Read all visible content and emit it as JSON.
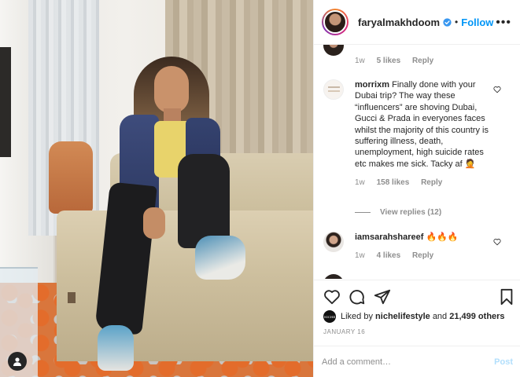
{
  "header": {
    "username": "faryalmakhdoom",
    "dot": "•",
    "follow_label": "Follow",
    "more_label": "•••"
  },
  "comments": [
    {
      "user": "",
      "text": "",
      "time": "1w",
      "likes": "5 likes",
      "reply": "Reply"
    },
    {
      "user": "morrixm",
      "text": "Finally done with your Dubai trip? The way these “influencers” are shoving Dubai, Gucci & Prada in everyones faces whilst the majority of this country is suffering illness, death, unemployment, high suicide rates etc makes me sick. Tacky af 🤦",
      "time": "1w",
      "likes": "158 likes",
      "reply": "Reply",
      "view_replies": "View replies (12)"
    },
    {
      "user": "iamsarahshareef",
      "text": "🔥🔥🔥",
      "time": "1w",
      "likes": "4 likes",
      "reply": "Reply"
    }
  ],
  "likes": {
    "prefix": "Liked by",
    "user": "nichelifestyle",
    "and": "and",
    "others": "21,499 others",
    "avatar_text": "NICHE"
  },
  "date": "JANUARY 16",
  "add_comment": {
    "placeholder": "Add a comment…",
    "post_label": "Post"
  },
  "colors": {
    "accent": "#0095f6",
    "post_disabled": "#b2dffc",
    "secondary_text": "#8e8e8e"
  },
  "icons": [
    "verified-badge-icon",
    "more-options-icon",
    "heart-icon",
    "comment-icon",
    "share-icon",
    "bookmark-icon",
    "tagged-user-icon"
  ]
}
